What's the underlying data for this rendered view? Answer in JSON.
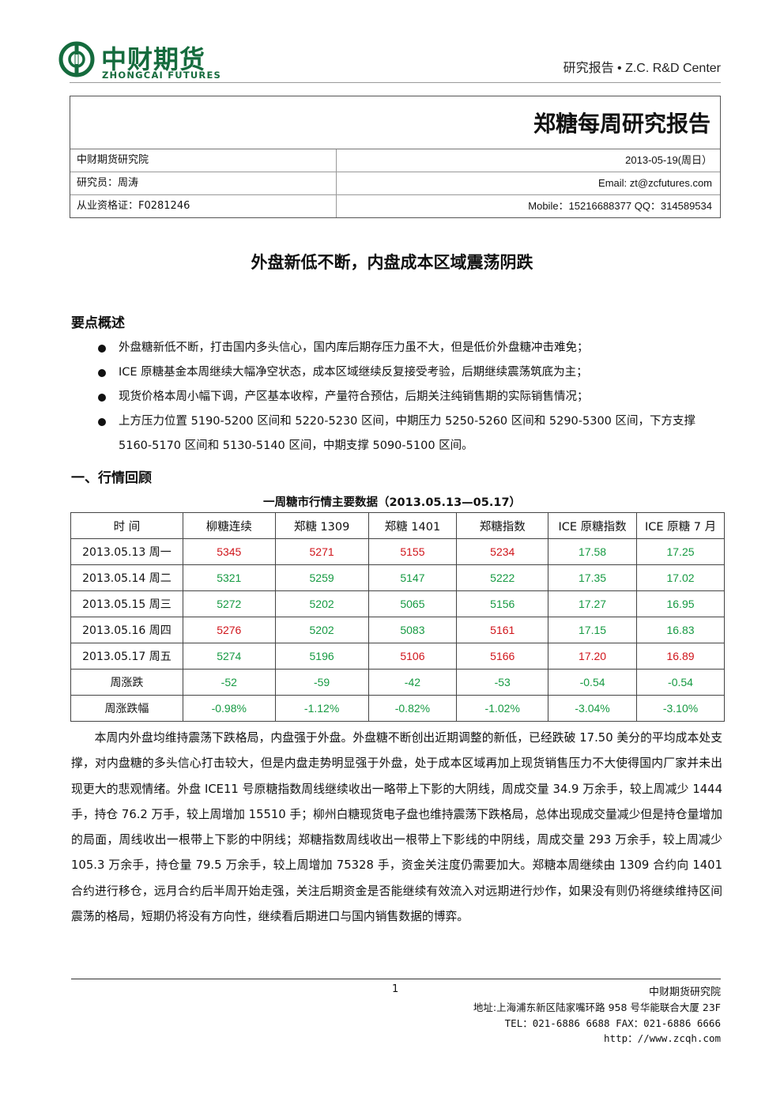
{
  "header": {
    "logo_cn": "中财期货",
    "logo_en": "ZHONGCAI FUTURES",
    "right_text": "研究报告 •  Z.C.    R&D Center"
  },
  "info": {
    "title": "郑糖每周研究报告",
    "rows": [
      {
        "left": "中财期货研究院",
        "right": "2013-05-19(周日）"
      },
      {
        "left": "研究员：周涛",
        "right": "Email:  zt@zcfutures.com"
      },
      {
        "left": "从业资格证：F0281246",
        "right": "Mobile：15216688377    QQ：314589534"
      }
    ]
  },
  "headline": "外盘新低不断，内盘成本区域震荡阴跌",
  "summary": {
    "title": "要点概述",
    "bullets": [
      "外盘糖新低不断，打击国内多头信心，国内库后期存压力虽不大，但是低价外盘糖冲击难免；",
      "ICE 原糖基金本周继续大幅净空状态，成本区域继续反复接受考验，后期继续震荡筑底为主；",
      "现货价格本周小幅下调，产区基本收榨，产量符合预估，后期关注纯销售期的实际销售情况；",
      "上方压力位置 5190-5200 区间和 5220-5230 区间，中期压力 5250-5260 区间和 5290-5300 区间，下方支撑 5160-5170 区间和 5130-5140 区间，中期支撑 5090-5100 区间。"
    ]
  },
  "review": {
    "title": "一、行情回顾",
    "table_caption": "一周糖市行情主要数据（2013.05.13—05.17）",
    "headers": [
      "时  间",
      "柳糖连续",
      "郑糖 1309",
      "郑糖 1401",
      "郑糖指数",
      "ICE 原糖指数",
      "ICE 原糖 7 月"
    ],
    "rows": [
      {
        "label": "2013.05.13 周一",
        "cells": [
          {
            "v": "5345",
            "c": "red"
          },
          {
            "v": "5271",
            "c": "red"
          },
          {
            "v": "5155",
            "c": "red"
          },
          {
            "v": "5234",
            "c": "red"
          },
          {
            "v": "17.58",
            "c": "green"
          },
          {
            "v": "17.25",
            "c": "green"
          }
        ]
      },
      {
        "label": "2013.05.14 周二",
        "cells": [
          {
            "v": "5321",
            "c": "green"
          },
          {
            "v": "5259",
            "c": "green"
          },
          {
            "v": "5147",
            "c": "green"
          },
          {
            "v": "5222",
            "c": "green"
          },
          {
            "v": "17.35",
            "c": "green"
          },
          {
            "v": "17.02",
            "c": "green"
          }
        ]
      },
      {
        "label": "2013.05.15 周三",
        "cells": [
          {
            "v": "5272",
            "c": "green"
          },
          {
            "v": "5202",
            "c": "green"
          },
          {
            "v": "5065",
            "c": "green"
          },
          {
            "v": "5156",
            "c": "green"
          },
          {
            "v": "17.27",
            "c": "green"
          },
          {
            "v": "16.95",
            "c": "green"
          }
        ]
      },
      {
        "label": "2013.05.16 周四",
        "cells": [
          {
            "v": "5276",
            "c": "red"
          },
          {
            "v": "5202",
            "c": "green"
          },
          {
            "v": "5083",
            "c": "green"
          },
          {
            "v": "5161",
            "c": "red"
          },
          {
            "v": "17.15",
            "c": "green"
          },
          {
            "v": "16.83",
            "c": "green"
          }
        ]
      },
      {
        "label": "2013.05.17 周五",
        "cells": [
          {
            "v": "5274",
            "c": "green"
          },
          {
            "v": "5196",
            "c": "green"
          },
          {
            "v": "5106",
            "c": "red"
          },
          {
            "v": "5166",
            "c": "red"
          },
          {
            "v": "17.20",
            "c": "red"
          },
          {
            "v": "16.89",
            "c": "red"
          }
        ]
      },
      {
        "label": "周涨跌",
        "cells": [
          {
            "v": "-52",
            "c": "green"
          },
          {
            "v": "-59",
            "c": "green"
          },
          {
            "v": "-42",
            "c": "green"
          },
          {
            "v": "-53",
            "c": "green"
          },
          {
            "v": "-0.54",
            "c": "green"
          },
          {
            "v": "-0.54",
            "c": "green"
          }
        ]
      },
      {
        "label": "周涨跌幅",
        "cells": [
          {
            "v": "-0.98%",
            "c": "green"
          },
          {
            "v": "-1.12%",
            "c": "green"
          },
          {
            "v": "-0.82%",
            "c": "green"
          },
          {
            "v": "-1.02%",
            "c": "green"
          },
          {
            "v": "-3.04%",
            "c": "green"
          },
          {
            "v": "-3.10%",
            "c": "green"
          }
        ]
      }
    ],
    "paragraph": "本周内外盘均维持震荡下跌格局，内盘强于外盘。外盘糖不断创出近期调整的新低，已经跌破 17.50 美分的平均成本处支撑，对内盘糖的多头信心打击较大，但是内盘走势明显强于外盘，处于成本区域再加上现货销售压力不大使得国内厂家并未出现更大的悲观情绪。外盘 ICE11 号原糖指数周线继续收出一略带上下影的大阴线，周成交量 34.9 万余手，较上周减少 1444 手，持仓 76.2 万手，较上周增加 15510 手；柳州白糖现货电子盘也维持震荡下跌格局，总体出现成交量减少但是持仓量增加的局面，周线收出一根带上下影的中阴线；郑糖指数周线收出一根带上下影线的中阴线，周成交量 293 万余手，较上周减少 105.3 万余手，持仓量 79.5 万余手，较上周增加 75328 手，资金关注度仍需要加大。郑糖本周继续由 1309 合约向 1401 合约进行移仓，远月合约后半周开始走强，关注后期资金是否能继续有效流入对远期进行炒作，如果没有则仍将继续维持区间震荡的格局，短期仍将没有方向性，继续看后期进口与国内销售数据的博弈。"
  },
  "footer": {
    "page": "1",
    "org": "中财期货研究院",
    "address": "地址:上海浦东新区陆家嘴环路 958 号华能联合大厦 23F",
    "tel": "TEL：021-6886 6688 FAX：021-6886 6666",
    "web": "http：//www.zcqh.com"
  },
  "colors": {
    "brand": "#156b3d",
    "up": "#d0151b",
    "down": "#169a42"
  }
}
